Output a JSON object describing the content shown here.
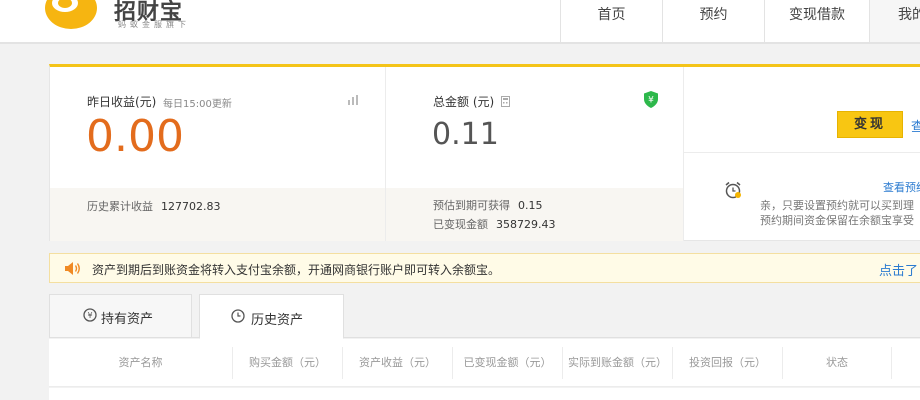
{
  "header": {
    "logo_title": "招财宝",
    "logo_subtitle": "蚂蚁金服旗下",
    "nav": [
      "首页",
      "预约",
      "变现借款",
      "我的"
    ]
  },
  "summary": {
    "yesterday": {
      "label": "昨日收益(元)",
      "note": "每日15:00更新",
      "value": "0.00",
      "history_label": "历史累计收益",
      "history_value": "127702.83"
    },
    "total": {
      "label": "总金额 (元)",
      "value": "0.11",
      "expected_label": "预估到期可获得",
      "expected_value": "0.15",
      "cashed_label": "已变现金额",
      "cashed_value": "358729.43"
    },
    "actions": {
      "cashout_button": "变现",
      "cashout_link": "查",
      "reserve_link": "查看预约",
      "tip_line1": "亲，只要设置预约就可以买到理",
      "tip_line2": "预约期间资金保留在余额宝享受"
    }
  },
  "notice": {
    "text": "资产到期后到账资金将转入支付宝余额，开通网商银行账户即可转入余额宝。",
    "link": "点击了"
  },
  "tabs": [
    {
      "label": "持有资产"
    },
    {
      "label": "历史资产"
    }
  ],
  "table": {
    "columns": [
      "资产名称",
      "购买金额（元）",
      "资产收益（元）",
      "已变现金额（元）",
      "实际到账金额（元）",
      "投资回报（元）",
      "状态"
    ]
  },
  "colors": {
    "accent": "#f4c419",
    "value_orange": "#e36c1d",
    "link_blue": "#2b7bd0",
    "shield_green": "#2db84b"
  }
}
